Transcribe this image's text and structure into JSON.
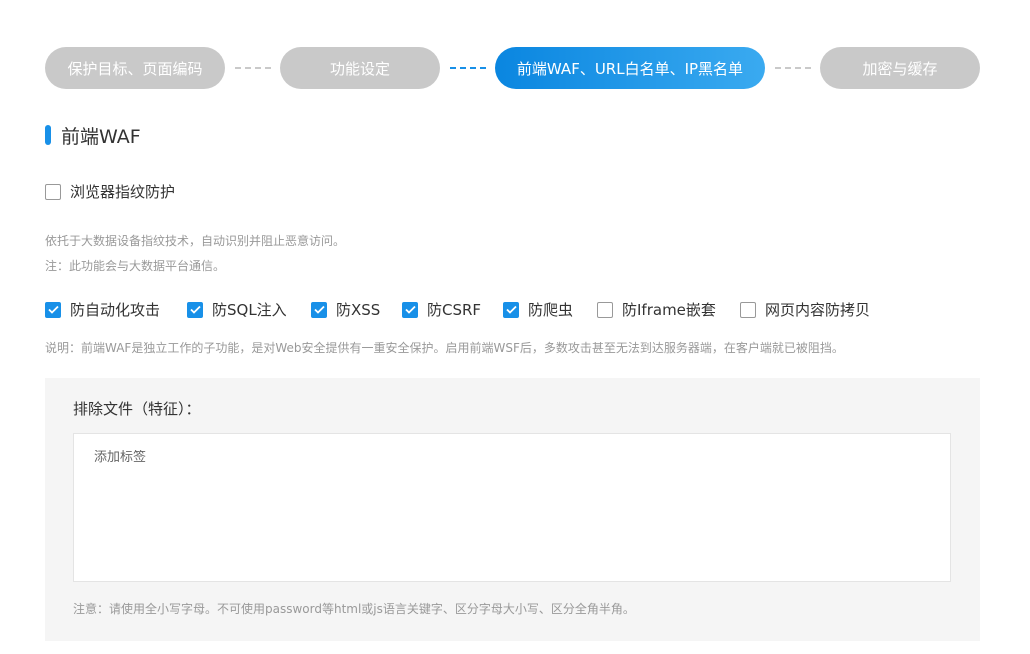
{
  "stepper": {
    "steps": [
      {
        "label": "保护目标、页面编码",
        "state": "inactive"
      },
      {
        "label": "功能设定",
        "state": "inactive"
      },
      {
        "label": "前端WAF、URL白名单、IP黑名单",
        "state": "active"
      },
      {
        "label": "加密与缓存",
        "state": "inactive"
      }
    ]
  },
  "section": {
    "title": "前端WAF"
  },
  "fingerprint": {
    "label": "浏览器指纹防护",
    "checked": false,
    "desc_line1": "依托于大数据设备指纹技术，自动识别并阻止恶意访问。",
    "desc_line2": "注：此功能会与大数据平台通信。"
  },
  "options": [
    {
      "label": "防自动化攻击",
      "checked": true
    },
    {
      "label": "防SQL注入",
      "checked": true
    },
    {
      "label": "防XSS",
      "checked": true
    },
    {
      "label": "防CSRF",
      "checked": true
    },
    {
      "label": "防爬虫",
      "checked": true
    },
    {
      "label": "防Iframe嵌套",
      "checked": false
    },
    {
      "label": "网页内容防拷贝",
      "checked": false
    }
  ],
  "explain": "说明：前端WAF是独立工作的子功能，是对Web安全提供有一重安全保护。启用前端WSF后，多数攻击甚至无法到达服务器端，在客户端就已被阻挡。",
  "exclude": {
    "label": "排除文件（特征）：",
    "placeholder": "添加标签",
    "value": "",
    "note": "注意：请使用全小写字母。不可使用password等html或js语言关键字、区分字母大小写、区分全角半角。"
  },
  "colors": {
    "accent": "#1890e8",
    "step_inactive": "#c9c9c9",
    "panel_bg": "#f5f5f5"
  }
}
